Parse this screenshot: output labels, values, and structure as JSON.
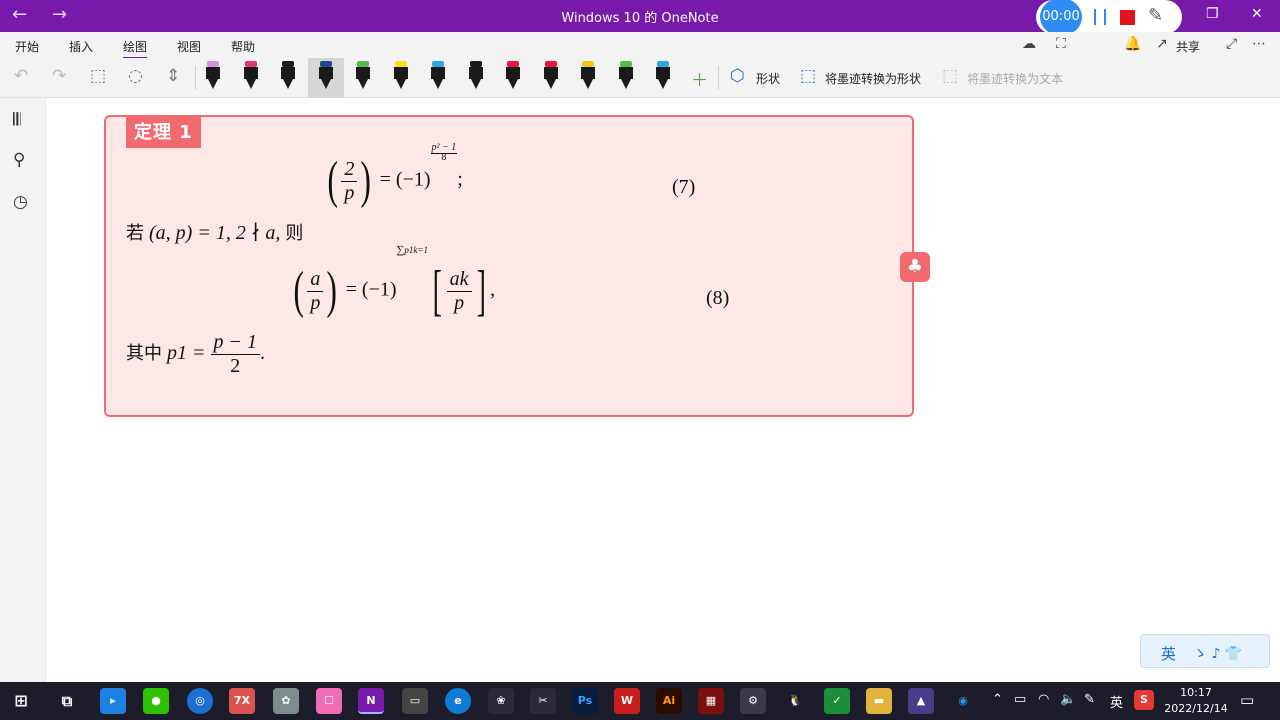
{
  "window": {
    "title": "Windows 10 的 OneNote",
    "back": "←",
    "forward": "→",
    "minimize": "—",
    "restore": "❐",
    "close": "✕"
  },
  "recorder": {
    "timer": "00:00"
  },
  "menu": {
    "items": [
      "开始",
      "插入",
      "绘图",
      "视图",
      "帮助"
    ],
    "active": "绘图",
    "share": "共享"
  },
  "toolbar": {
    "shapes_label": "形状",
    "ink_to_shape_label": "将墨迹转换为形状",
    "ink_to_text_label": "将墨迹转换为文本",
    "pen_colors": [
      "#d88ee0",
      "#e0357a",
      "#1a1a1a",
      "#1f4b8a",
      "#58b947",
      "#f3e21b",
      "#27a9e1",
      "#1a1a1a",
      "#e8173f",
      "#e8173f",
      "#f7c51b",
      "#58b947",
      "#27a9e1"
    ]
  },
  "theorem": {
    "label": "定理 1",
    "eq7": {
      "num": "2",
      "den": "p",
      "rhs": "= (−1)",
      "exp_num": "p² − 1",
      "exp_den": "8",
      "tail": ";",
      "number": "(7)"
    },
    "cond_prefix": "若",
    "cond_math": "(a, p) = 1, 2 ∤ a,",
    "cond_suffix": "则",
    "eq8": {
      "num": "a",
      "den": "p",
      "rhs": "= (−1)",
      "sum": "∑",
      "sum_upper": "p1",
      "sum_lower": "k=1",
      "inner_num": "ak",
      "inner_den": "p",
      "tail": ",",
      "number": "(8)"
    },
    "where_prefix": "其中",
    "where_math": "p1 =",
    "where_num": "p − 1",
    "where_den": "2",
    "where_tail": "."
  },
  "ime": {
    "lang": "英",
    "decor": "ゝ ♪ 👕"
  },
  "taskbar": {
    "apps": [
      {
        "name": "微信",
        "color": "#2dc100"
      },
      {
        "name": "7X",
        "color": "#d9534f"
      },
      {
        "name": "N",
        "color": "#7719aa"
      },
      {
        "name": "Ps",
        "color": "#0a1c3c"
      },
      {
        "name": "Ai",
        "color": "#2b0a00"
      },
      {
        "name": "S",
        "color": "#e53935"
      }
    ],
    "tray_lang": "英",
    "time": "10:17",
    "date": "2022/12/14"
  }
}
